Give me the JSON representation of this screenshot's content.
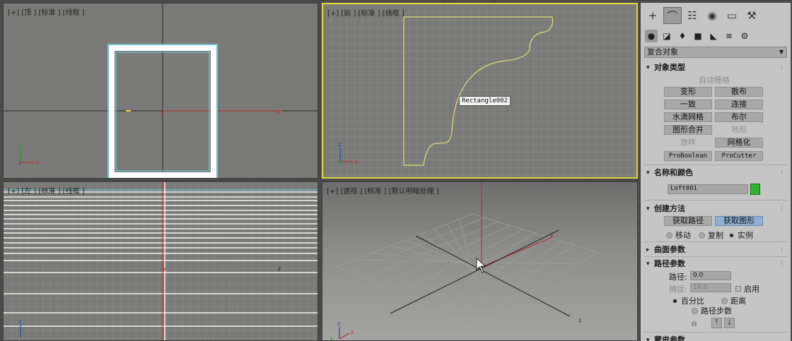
{
  "viewports": {
    "top": {
      "label": "[+] [顶 ] [标准 ] [线框 ]"
    },
    "front": {
      "label": "[+] [前 ] [标准 ] [线框 ]",
      "tooltip": "Rectangle002"
    },
    "left": {
      "label": "[+] [左 ] [标准 ] [线框 ]"
    },
    "perspective": {
      "label": "[+] [透视 ] [标准 ] [默认明暗处理 ]"
    }
  },
  "axes": {
    "x": "x",
    "y": "y",
    "z": "z"
  },
  "panel": {
    "tabs": [
      "create-icon",
      "modify-icon",
      "hierarchy-icon",
      "motion-icon",
      "display-icon",
      "utilities-icon"
    ],
    "category_dropdown": "复合对象",
    "object_type": {
      "title": "对象类型",
      "autogrid": "自动栅格",
      "buttons": [
        "变形",
        "散布",
        "一致",
        "连接",
        "水滴网格",
        "布尔",
        "图形合并",
        "地形",
        "放样",
        "网格化",
        "ProBoolean",
        "ProCutter"
      ]
    },
    "name_color": {
      "title": "名称和颜色",
      "name": "Loft001",
      "color": "#2fb52f"
    },
    "creation_method": {
      "title": "创建方法",
      "get_path": "获取路径",
      "get_shape": "获取图形",
      "move": "移动",
      "copy": "复制",
      "instance": "实例"
    },
    "surface_params": {
      "title": "曲面参数"
    },
    "path_params": {
      "title": "路径参数",
      "path_label": "路径:",
      "path_value": "0.0",
      "snap_label": "捕捉:",
      "snap_value": "10.0",
      "enable": "启用",
      "percentage": "百分比",
      "distance": "距离",
      "path_steps": "路径步数"
    },
    "skin_params": {
      "title": "蒙皮参数"
    }
  }
}
